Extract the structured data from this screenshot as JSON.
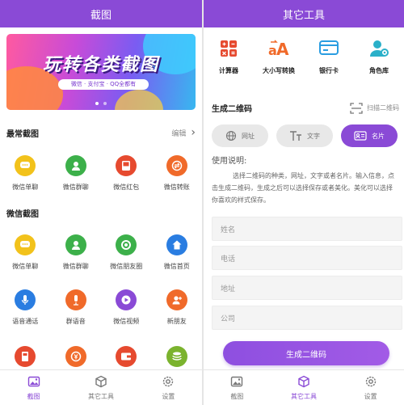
{
  "left": {
    "title": "截图",
    "banner": {
      "headline": "玩转各类截图",
      "subline": "微信 · 支付宝 · QQ全都有"
    },
    "common": {
      "heading": "最常截图",
      "edit": "编辑",
      "items": [
        {
          "label": "微信单聊",
          "color": "#f2c21b",
          "icon": "chat-icon"
        },
        {
          "label": "微信群聊",
          "color": "#3cb04a",
          "icon": "group-icon"
        },
        {
          "label": "微信红包",
          "color": "#e64a2f",
          "icon": "red-packet-icon"
        },
        {
          "label": "微信转账",
          "color": "#f06a2a",
          "icon": "transfer-icon"
        }
      ]
    },
    "wechat": {
      "heading": "微信截图",
      "rows": [
        [
          {
            "label": "微信单聊",
            "color": "#f2c21b",
            "icon": "chat-icon"
          },
          {
            "label": "微信群聊",
            "color": "#3cb04a",
            "icon": "group-icon"
          },
          {
            "label": "微信朋友圈",
            "color": "#3cb04a",
            "icon": "moments-icon"
          },
          {
            "label": "微信首页",
            "color": "#2a7de1",
            "icon": "home-icon"
          }
        ],
        [
          {
            "label": "语音通话",
            "color": "#2a7de1",
            "icon": "mic-icon"
          },
          {
            "label": "群语音",
            "color": "#f06a2a",
            "icon": "group-mic-icon"
          },
          {
            "label": "微信视频",
            "color": "#8a4ad6",
            "icon": "video-icon"
          },
          {
            "label": "新朋友",
            "color": "#f06a2a",
            "icon": "add-friend-icon"
          }
        ],
        [
          {
            "label": "",
            "color": "#e64a2f",
            "icon": "receipt-icon"
          },
          {
            "label": "",
            "color": "#f06a2a",
            "icon": "money-icon"
          },
          {
            "label": "",
            "color": "#e64a2f",
            "icon": "wallet-icon"
          },
          {
            "label": "",
            "color": "#7bb32e",
            "icon": "coins-icon"
          }
        ]
      ]
    },
    "tabs": [
      {
        "label": "截图",
        "icon": "image-icon",
        "active": true
      },
      {
        "label": "其它工具",
        "icon": "cube-icon",
        "active": false
      },
      {
        "label": "设置",
        "icon": "gear-icon",
        "active": false
      }
    ]
  },
  "right": {
    "title": "其它工具",
    "tools": [
      {
        "label": "计算器",
        "icon": "calculator-icon",
        "color": "#e64a2f"
      },
      {
        "label": "大小写转换",
        "icon": "case-convert-icon",
        "color": "#f06a2a"
      },
      {
        "label": "银行卡",
        "icon": "bank-card-icon",
        "color": "#2a9de1"
      },
      {
        "label": "角色库",
        "icon": "role-library-icon",
        "color": "#2ab0c9"
      }
    ],
    "qr": {
      "heading": "生成二维码",
      "scan": "扫描二维码",
      "segments": [
        {
          "label": "网址",
          "icon": "globe-icon",
          "active": false
        },
        {
          "label": "文字",
          "icon": "text-icon",
          "active": false
        },
        {
          "label": "名片",
          "icon": "card-icon",
          "active": true
        }
      ],
      "usage_title": "使用说明:",
      "usage_text": "选择二维码的种类，网址，文字或者名片。输入信息，点击生成二维码，生成之后可以选择保存或者美化。美化可以选择你喜欢的样式保存。",
      "fields": [
        {
          "placeholder": "姓名"
        },
        {
          "placeholder": "电话"
        },
        {
          "placeholder": "地址"
        },
        {
          "placeholder": "公司"
        }
      ],
      "button": "生成二维码"
    },
    "tabs": [
      {
        "label": "截图",
        "icon": "image-icon",
        "active": false
      },
      {
        "label": "其它工具",
        "icon": "cube-icon",
        "active": true
      },
      {
        "label": "设置",
        "icon": "gear-icon",
        "active": false
      }
    ]
  },
  "accent": "#8a4ad6"
}
